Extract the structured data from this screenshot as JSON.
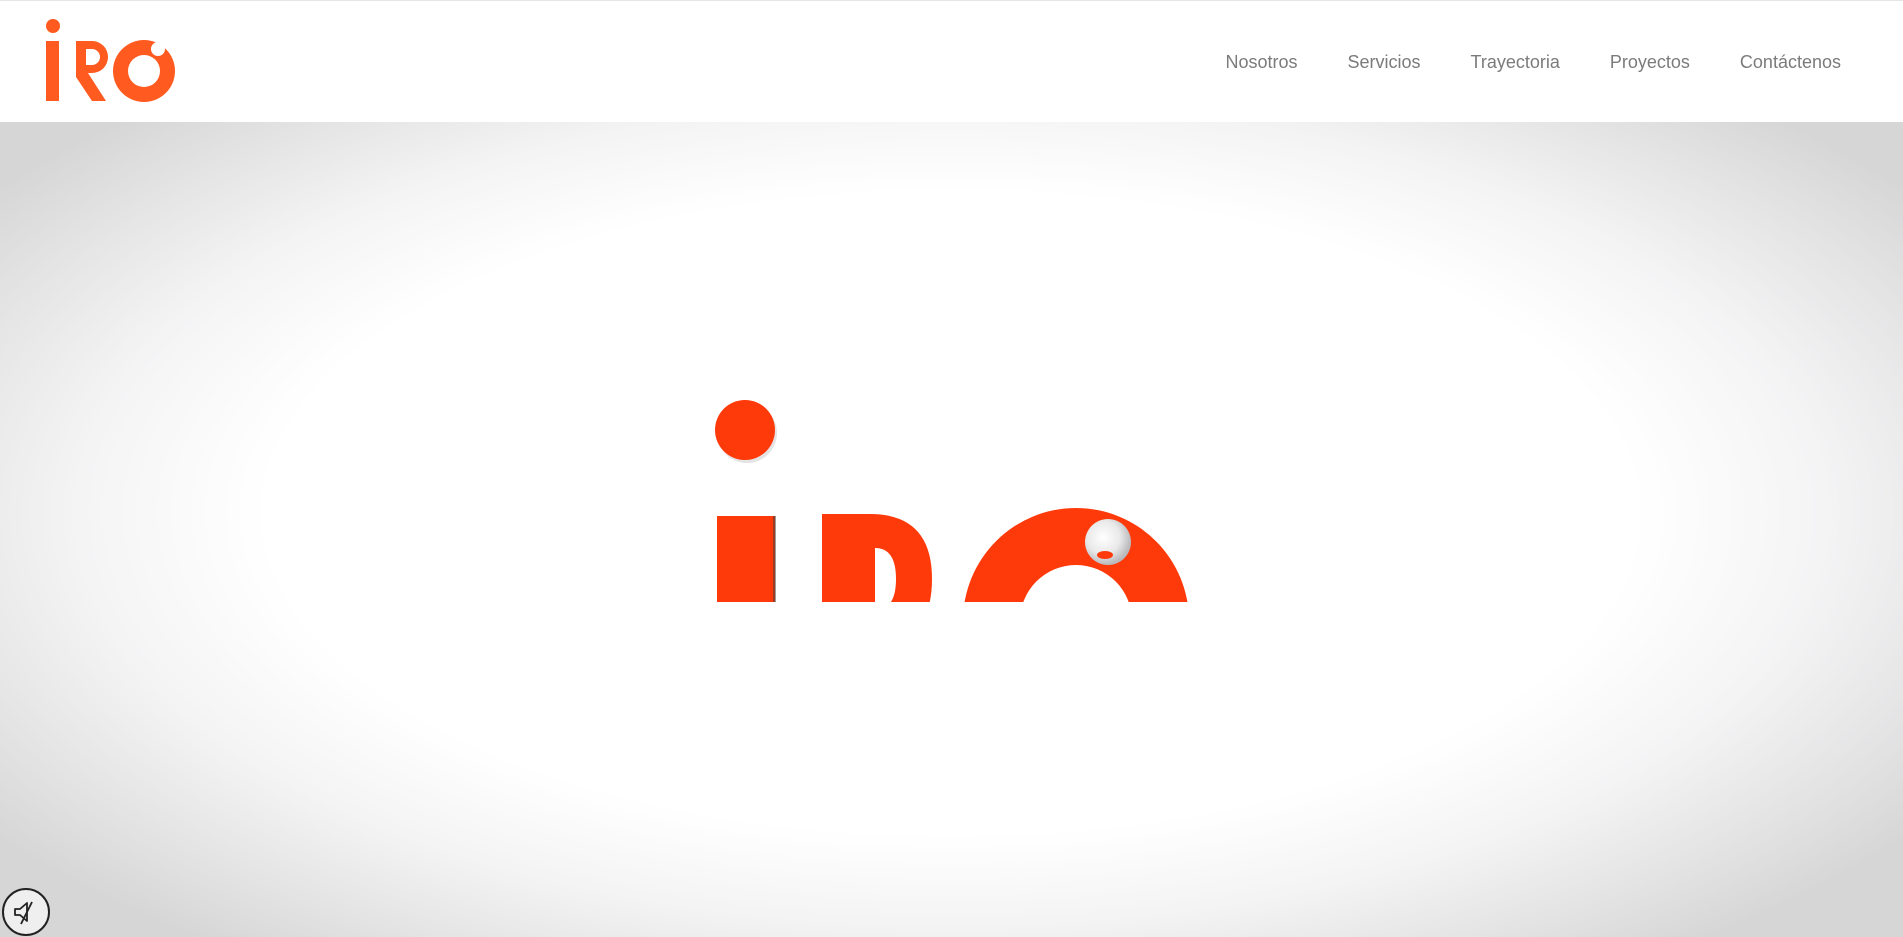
{
  "brand": {
    "logo_text": "iRO",
    "accent_color": "#ff3a0a",
    "header_logo_color": "#ff5a1f"
  },
  "nav": {
    "items": [
      {
        "label": "Nosotros"
      },
      {
        "label": "Servicios"
      },
      {
        "label": "Trayectoria"
      },
      {
        "label": "Proyectos"
      },
      {
        "label": "Contáctenos"
      }
    ]
  },
  "hero": {
    "background": "#ffffff",
    "vignette_color": "#d6d6d7",
    "scroll_icon": "chevron-down-icon"
  },
  "controls": {
    "audio_icon": "speaker-muted-icon"
  }
}
